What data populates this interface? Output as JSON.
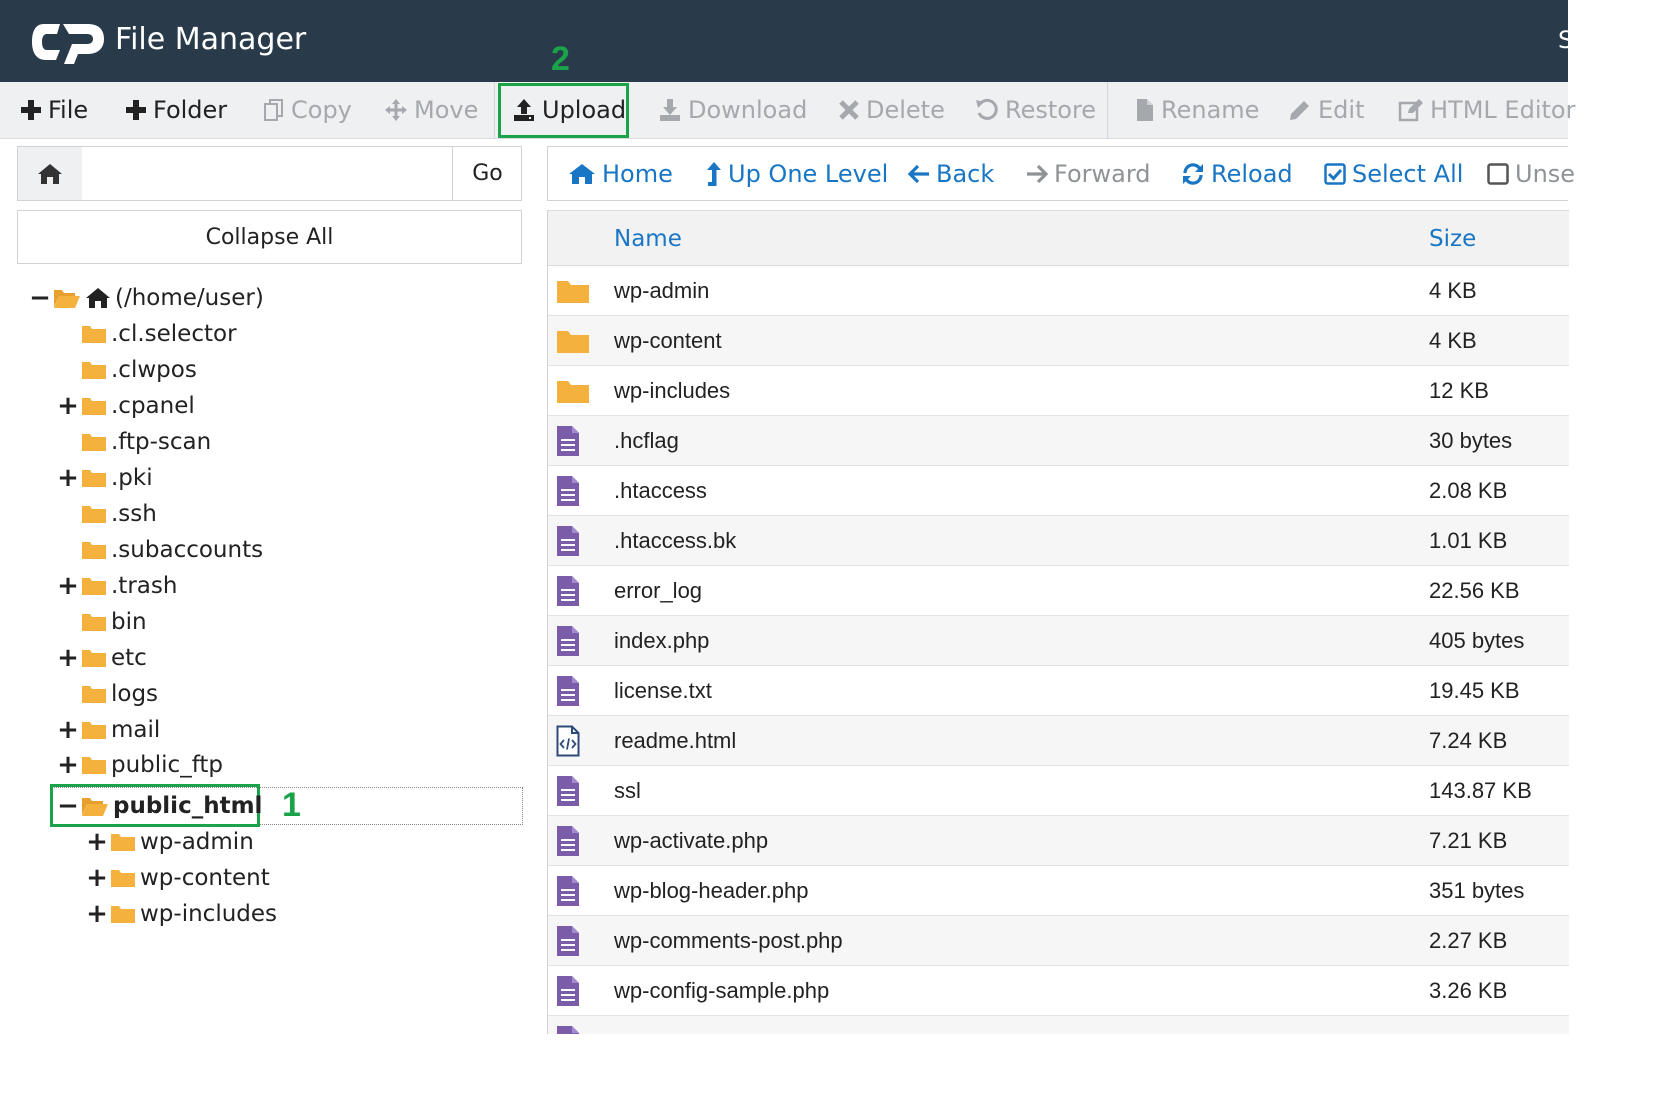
{
  "header": {
    "title": "File Manager",
    "user_initial": "S"
  },
  "toolbar": {
    "file": "File",
    "folder": "Folder",
    "copy": "Copy",
    "move": "Move",
    "upload": "Upload",
    "download": "Download",
    "delete": "Delete",
    "restore": "Restore",
    "rename": "Rename",
    "edit": "Edit",
    "html_editor": "HTML Editor"
  },
  "annotations": {
    "step1": "1",
    "step2": "2",
    "color": "#1ba34a"
  },
  "left": {
    "path_value": "",
    "go": "Go",
    "collapse_all": "Collapse All",
    "tree": [
      {
        "label": "(/home/user)",
        "toggle": "−",
        "icon": "home-icon"
      },
      {
        "label": ".cl.selector",
        "toggle": ""
      },
      {
        "label": ".clwpos",
        "toggle": ""
      },
      {
        "label": ".cpanel",
        "toggle": "+"
      },
      {
        "label": ".ftp-scan",
        "toggle": ""
      },
      {
        "label": ".pki",
        "toggle": "+"
      },
      {
        "label": ".ssh",
        "toggle": ""
      },
      {
        "label": ".subaccounts",
        "toggle": ""
      },
      {
        "label": ".trash",
        "toggle": "+"
      },
      {
        "label": "bin",
        "toggle": ""
      },
      {
        "label": "etc",
        "toggle": "+"
      },
      {
        "label": "logs",
        "toggle": ""
      },
      {
        "label": "mail",
        "toggle": "+"
      },
      {
        "label": "public_ftp",
        "toggle": "+"
      },
      {
        "label": "public_html",
        "toggle": "−",
        "selected": true
      },
      {
        "label": "wp-admin",
        "toggle": "+"
      },
      {
        "label": "wp-content",
        "toggle": "+"
      },
      {
        "label": "wp-includes",
        "toggle": "+"
      }
    ]
  },
  "nav": {
    "home": "Home",
    "up": "Up One Level",
    "back": "Back",
    "forward": "Forward",
    "reload": "Reload",
    "select_all": "Select All",
    "unselect": "Unse"
  },
  "table": {
    "col_name": "Name",
    "col_size": "Size",
    "rows": [
      {
        "name": "wp-admin",
        "size": "4 KB",
        "type": "folder"
      },
      {
        "name": "wp-content",
        "size": "4 KB",
        "type": "folder"
      },
      {
        "name": "wp-includes",
        "size": "12 KB",
        "type": "folder"
      },
      {
        "name": ".hcflag",
        "size": "30 bytes",
        "type": "file"
      },
      {
        "name": ".htaccess",
        "size": "2.08 KB",
        "type": "file"
      },
      {
        "name": ".htaccess.bk",
        "size": "1.01 KB",
        "type": "file"
      },
      {
        "name": "error_log",
        "size": "22.56 KB",
        "type": "file"
      },
      {
        "name": "index.php",
        "size": "405 bytes",
        "type": "file"
      },
      {
        "name": "license.txt",
        "size": "19.45 KB",
        "type": "file"
      },
      {
        "name": "readme.html",
        "size": "7.24 KB",
        "type": "html"
      },
      {
        "name": "ssl",
        "size": "143.87 KB",
        "type": "file"
      },
      {
        "name": "wp-activate.php",
        "size": "7.21 KB",
        "type": "file"
      },
      {
        "name": "wp-blog-header.php",
        "size": "351 bytes",
        "type": "file"
      },
      {
        "name": "wp-comments-post.php",
        "size": "2.27 KB",
        "type": "file"
      },
      {
        "name": "wp-config-sample.php",
        "size": "3.26 KB",
        "type": "file"
      },
      {
        "name": "",
        "size": "",
        "type": "file"
      }
    ]
  },
  "colors": {
    "header_bg": "#293a4a",
    "link": "#1976c5",
    "folder": "#f4b13e",
    "file": "#7a5ca8"
  }
}
